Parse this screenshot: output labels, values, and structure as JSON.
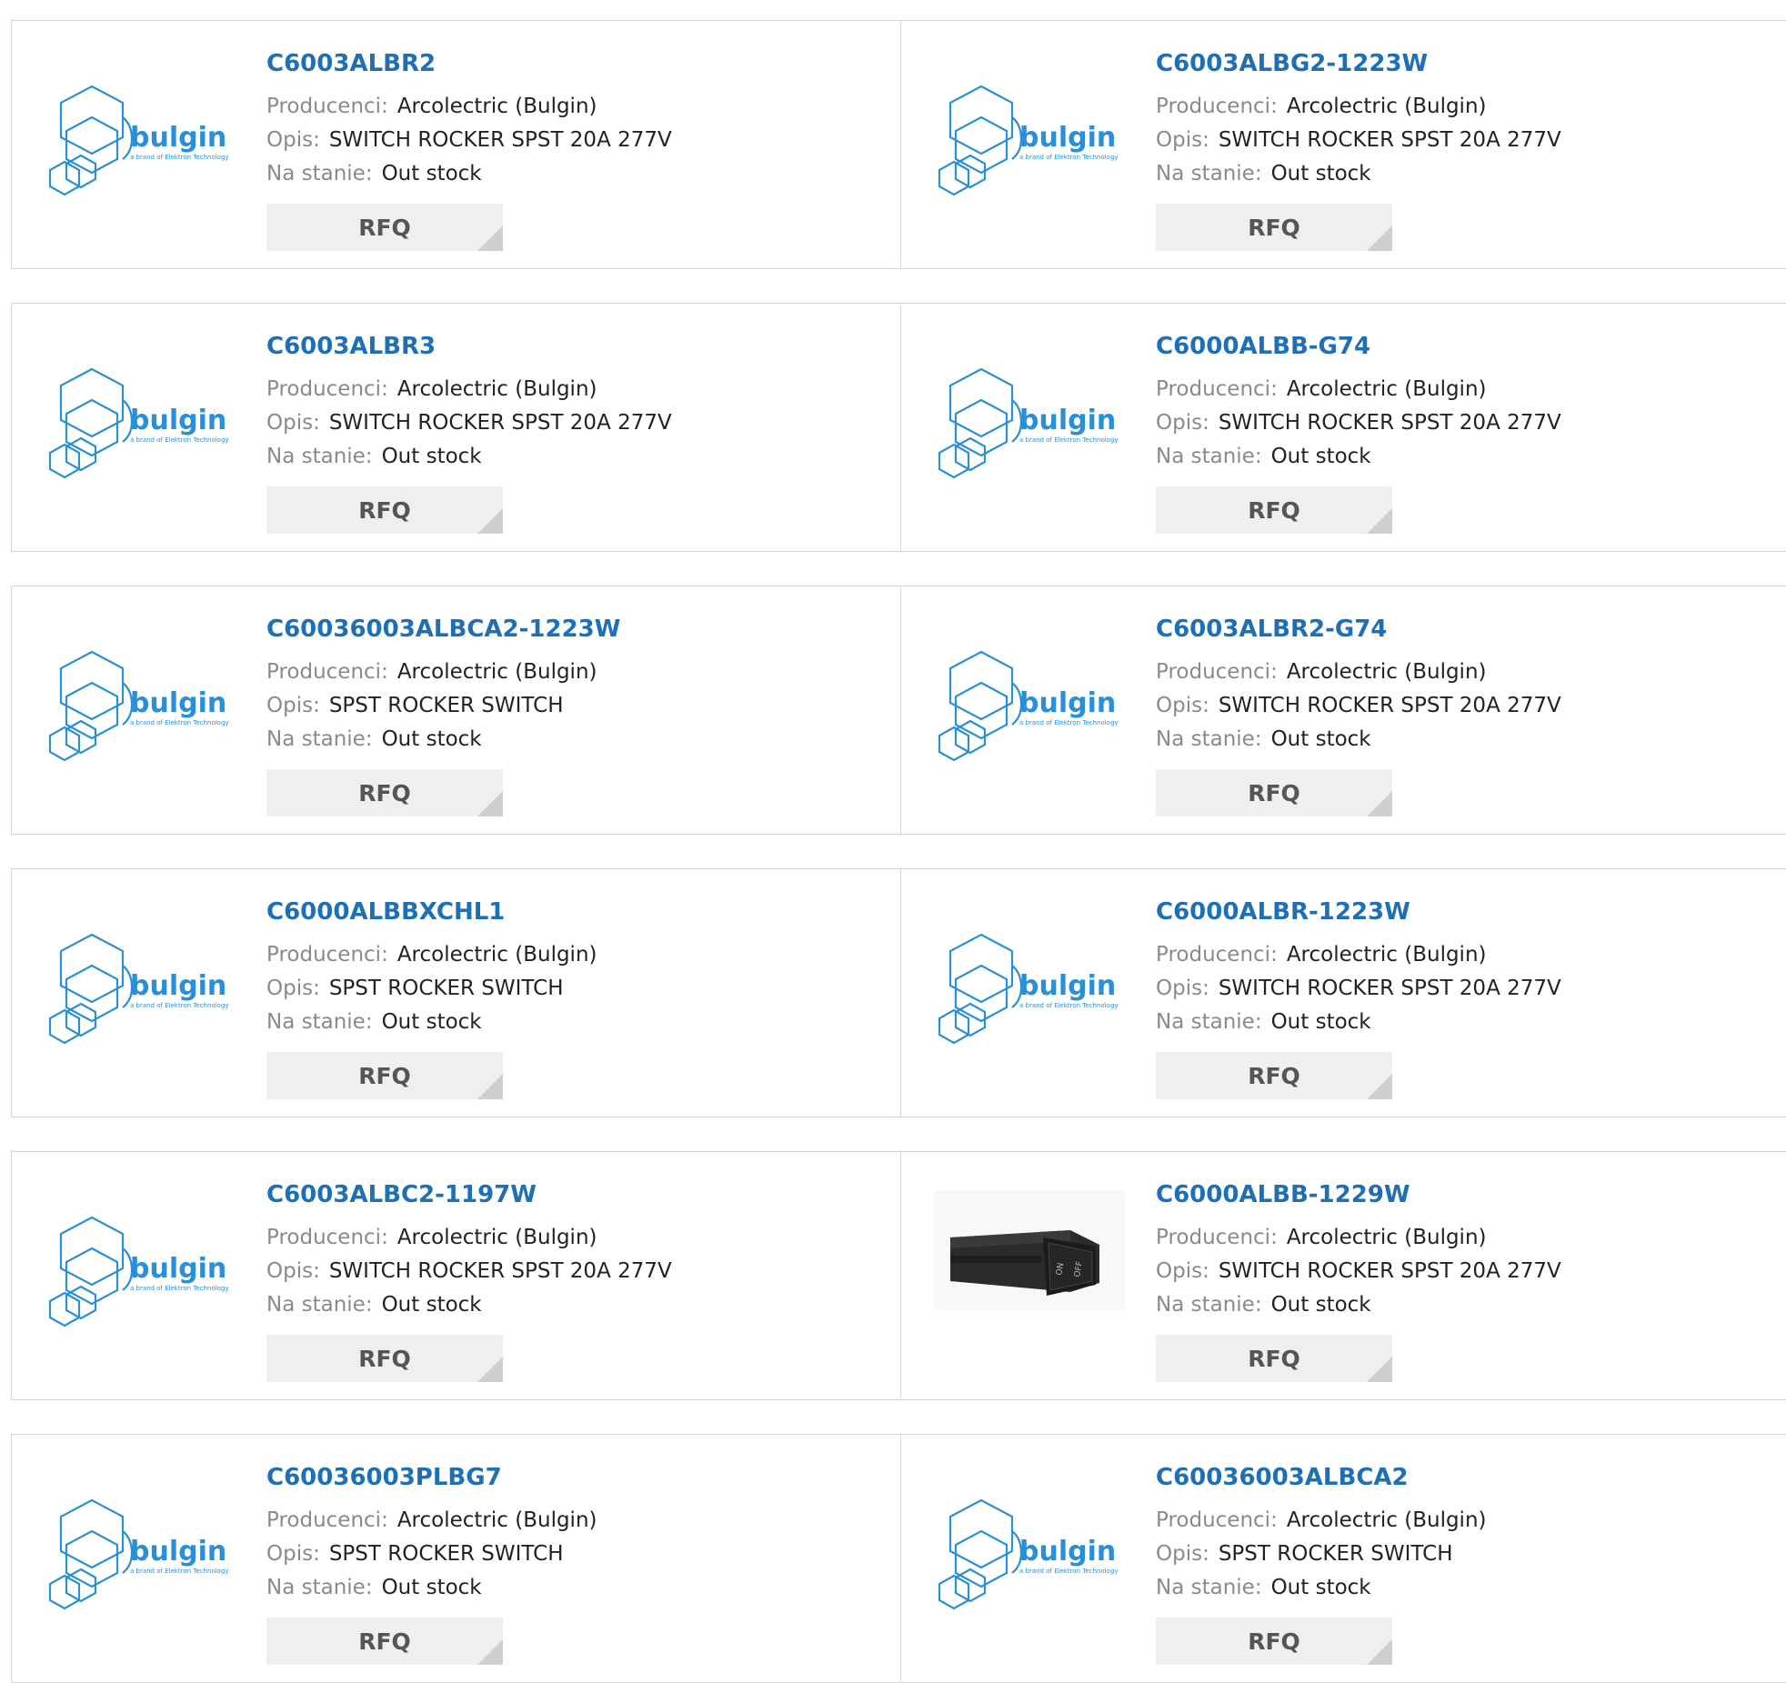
{
  "labels": {
    "manufacturer": "Producenci:",
    "description": "Opis:",
    "stock": "Na stanie:",
    "rfq": "RFQ"
  },
  "logo_text": {
    "name": "bulgin",
    "tagline": "a brand of Elektron Technology"
  },
  "colors": {
    "link": "#1f6fb5",
    "label": "#8a8a8a",
    "logo": "#2a8fd6",
    "rfq_bg": "#efefef"
  },
  "products": [
    {
      "part": "C6003ALBR2",
      "manufacturer": "Arcolectric (Bulgin)",
      "description": "SWITCH ROCKER SPST 20A 277V",
      "stock": "Out stock",
      "image": "bulgin-logo"
    },
    {
      "part": "C6003ALBG2-1223W",
      "manufacturer": "Arcolectric (Bulgin)",
      "description": "SWITCH ROCKER SPST 20A 277V",
      "stock": "Out stock",
      "image": "bulgin-logo"
    },
    {
      "part": "C6003ALBR3",
      "manufacturer": "Arcolectric (Bulgin)",
      "description": "SWITCH ROCKER SPST 20A 277V",
      "stock": "Out stock",
      "image": "bulgin-logo"
    },
    {
      "part": "C6000ALBB-G74",
      "manufacturer": "Arcolectric (Bulgin)",
      "description": "SWITCH ROCKER SPST 20A 277V",
      "stock": "Out stock",
      "image": "bulgin-logo"
    },
    {
      "part": "C60036003ALBCA2-1223W",
      "manufacturer": "Arcolectric (Bulgin)",
      "description": "SPST ROCKER SWITCH",
      "stock": "Out stock",
      "image": "bulgin-logo"
    },
    {
      "part": "C6003ALBR2-G74",
      "manufacturer": "Arcolectric (Bulgin)",
      "description": "SWITCH ROCKER SPST 20A 277V",
      "stock": "Out stock",
      "image": "bulgin-logo"
    },
    {
      "part": "C6000ALBBXCHL1",
      "manufacturer": "Arcolectric (Bulgin)",
      "description": "SPST ROCKER SWITCH",
      "stock": "Out stock",
      "image": "bulgin-logo"
    },
    {
      "part": "C6000ALBR-1223W",
      "manufacturer": "Arcolectric (Bulgin)",
      "description": "SWITCH ROCKER SPST 20A 277V",
      "stock": "Out stock",
      "image": "bulgin-logo"
    },
    {
      "part": "C6003ALBC2-1197W",
      "manufacturer": "Arcolectric (Bulgin)",
      "description": "SWITCH ROCKER SPST 20A 277V",
      "stock": "Out stock",
      "image": "bulgin-logo"
    },
    {
      "part": "C6000ALBB-1229W",
      "manufacturer": "Arcolectric (Bulgin)",
      "description": "SWITCH ROCKER SPST 20A 277V",
      "stock": "Out stock",
      "image": "rocker-switch-photo"
    },
    {
      "part": "C60036003PLBG7",
      "manufacturer": "Arcolectric (Bulgin)",
      "description": "SPST ROCKER SWITCH",
      "stock": "Out stock",
      "image": "bulgin-logo"
    },
    {
      "part": "C60036003ALBCA2",
      "manufacturer": "Arcolectric (Bulgin)",
      "description": "SPST ROCKER SWITCH",
      "stock": "Out stock",
      "image": "bulgin-logo"
    }
  ]
}
